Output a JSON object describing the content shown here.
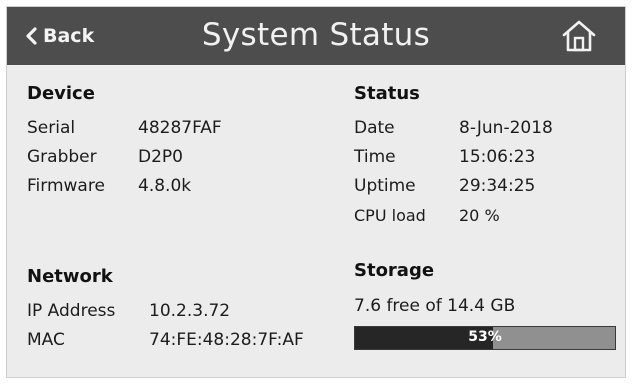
{
  "header": {
    "back_label": "Back",
    "title": "System Status"
  },
  "device": {
    "title": "Device",
    "rows": [
      {
        "label": "Serial",
        "value": "48287FAF"
      },
      {
        "label": "Grabber",
        "value": "D2P0"
      },
      {
        "label": "Firmware",
        "value": "4.8.0k"
      }
    ]
  },
  "status": {
    "title": "Status",
    "rows": [
      {
        "label": "Date",
        "value": "8-Jun-2018"
      },
      {
        "label": "Time",
        "value": "15:06:23"
      },
      {
        "label": "Uptime",
        "value": "29:34:25"
      },
      {
        "label": "CPU load",
        "value": "20 %"
      }
    ]
  },
  "network": {
    "title": "Network",
    "rows": [
      {
        "label": "IP Address",
        "value": "10.2.3.72"
      },
      {
        "label": "MAC",
        "value": "74:FE:48:28:7F:AF"
      }
    ]
  },
  "storage": {
    "title": "Storage",
    "summary": "7.6 free of 14.4 GB",
    "used_fraction": 0.53,
    "used_label": "53%"
  },
  "icons": {
    "back": "chevron-left-icon",
    "home": "home-icon"
  },
  "colors": {
    "header_bg": "#4d4d4d",
    "body_bg": "#ececec",
    "progress_fill": "#262626",
    "progress_track": "#909090"
  }
}
